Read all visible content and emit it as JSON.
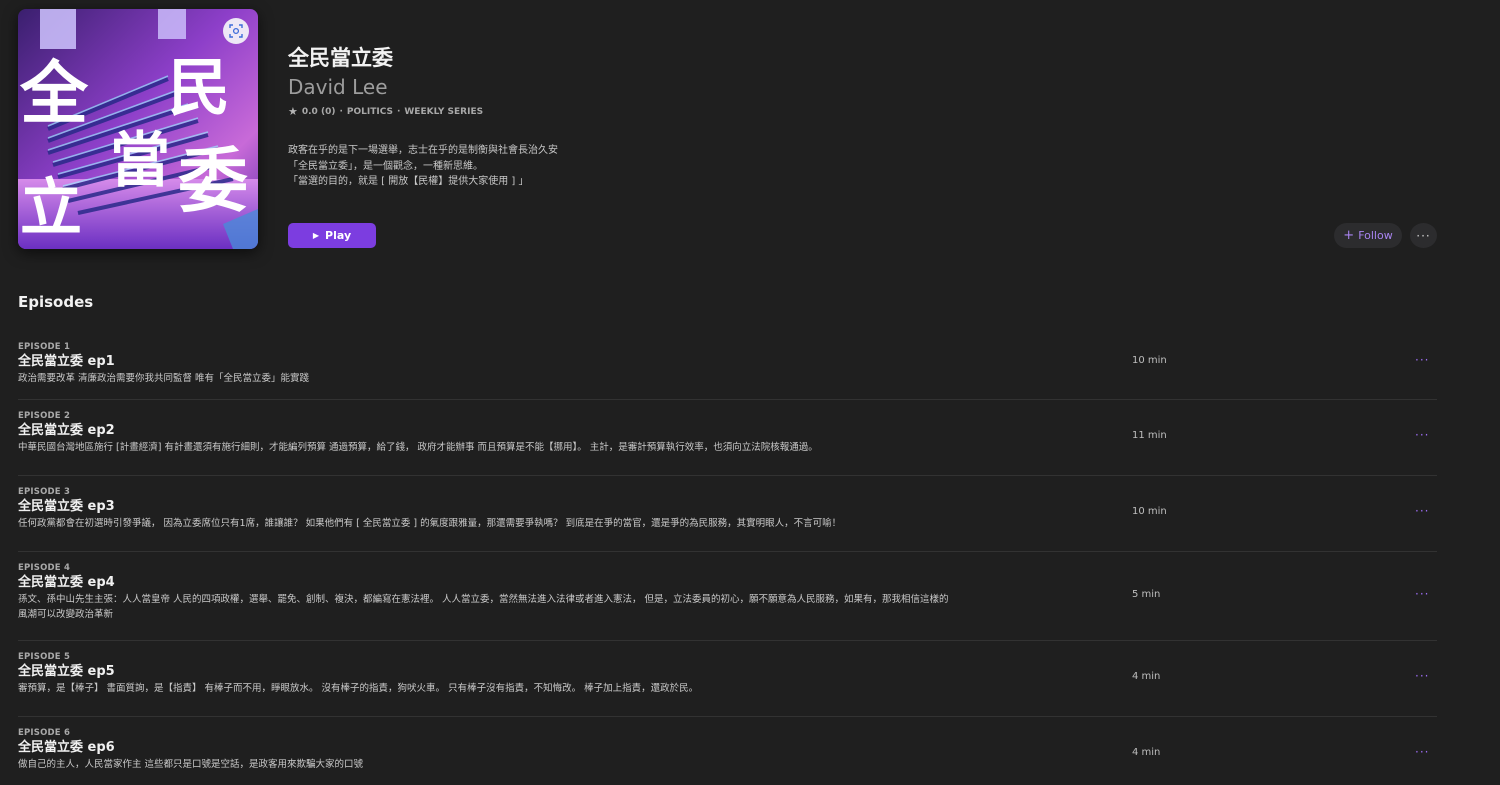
{
  "podcast": {
    "title": "全民當立委",
    "author": "David Lee",
    "rating": "0.0 (0)",
    "category": "POLITICS",
    "frequency": "WEEKLY SERIES",
    "separator": "·",
    "description": [
      "政客在乎的是下一場選舉，志士在乎的是制衡與社會長治久安",
      "「全民當立委」，是一個觀念，一種新思維。",
      "「當選的目的，就是 [ 開放【民權】提供大家使用 ] 」"
    ],
    "artwork_text": [
      "全",
      "民",
      "當",
      "立",
      "委"
    ],
    "artwork_action_icon": "scan-icon"
  },
  "actions": {
    "play_label": "Play",
    "follow_label": "Follow",
    "more_label": "···"
  },
  "episodes_heading": "Episodes",
  "episodes": [
    {
      "label": "EPISODE 1",
      "title": "全民當立委 ep1",
      "description": "政治需要改革 清廉政治需要你我共同監督 唯有「全民當立委」能實踐",
      "duration": "10 min"
    },
    {
      "label": "EPISODE 2",
      "title": "全民當立委 ep2",
      "description": "中華民國台灣地區施行 [計畫經濟] 有計畫還須有施行細則，才能編列預算 通過預算，給了錢， 政府才能辦事 而且預算是不能【挪用】。 主計，是審計預算執行效率，也須向立法院核報通過。",
      "duration": "11 min"
    },
    {
      "label": "EPISODE 3",
      "title": "全民當立委 ep3",
      "description": "任何政黨都會在初選時引發爭議， 因為立委席位只有1席，誰讓誰？ 如果他們有 [ 全民當立委 ] 的氣度跟雅量，那還需要爭執嗎？ 到底是在爭的當官，還是爭的為民服務，其實明眼人，不言可喻！",
      "duration": "10 min"
    },
    {
      "label": "EPISODE 4",
      "title": "全民當立委 ep4",
      "description": "孫文、孫中山先生主張：人人當皇帝 人民的四項政權，選舉、罷免、創制、複決，都編寫在憲法裡。 人人當立委，當然無法進入法律或者進入憲法， 但是，立法委員的初心，願不願意為人民服務，如果有，那我相信這樣的風潮可以改變政治革新",
      "duration": "5 min"
    },
    {
      "label": "EPISODE 5",
      "title": "全民當立委 ep5",
      "description": "審預算，是【棒子】 書面質詢，是【指責】 有棒子而不用，睜眼放水。 沒有棒子的指責，狗吠火車。 只有棒子沒有指責，不知悔改。 棒子加上指責，還政於民。",
      "duration": "4 min"
    },
    {
      "label": "EPISODE 6",
      "title": "全民當立委 ep6",
      "description": "做自己的主人，人民當家作主 這些都只是口號是空話，是政客用來欺騙大家的口號",
      "duration": "4 min"
    }
  ]
}
